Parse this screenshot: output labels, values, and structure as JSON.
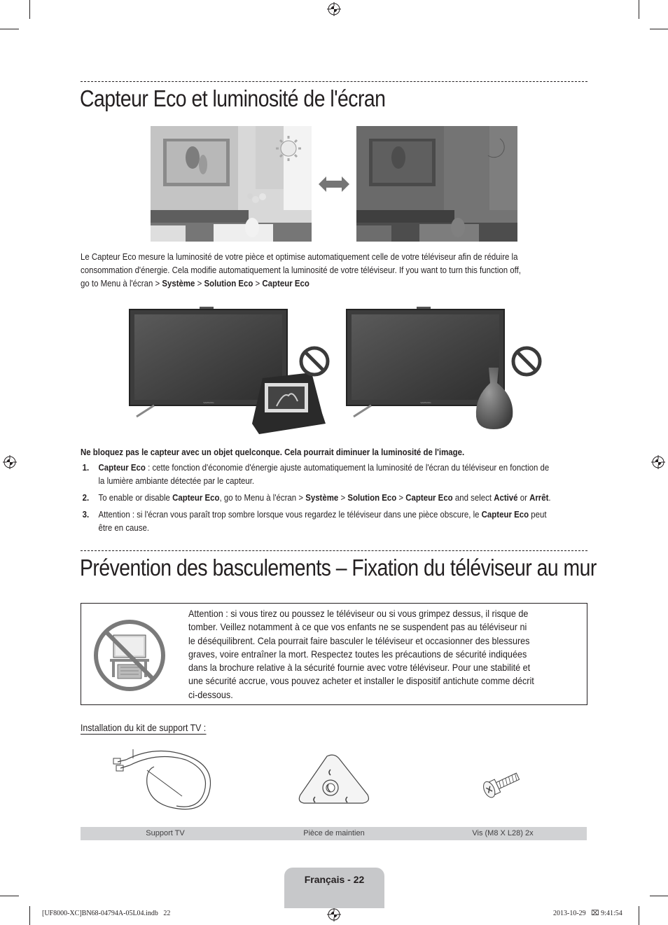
{
  "section1": {
    "title": "Capteur Eco et luminosité de l'écran",
    "intro": {
      "line1": "Le Capteur Eco mesure la luminosité de votre pièce et optimise automatiquement celle de votre téléviseur afin de réduire la",
      "line2": "consommation d'énergie. Cela modifie automatiquement la luminosité de votre téléviseur. If you want to turn this function off,",
      "line3_prefix": "go to Menu à l'écran > ",
      "path1": "Système",
      "sep": " > ",
      "path2": "Solution Eco",
      "path3": "Capteur Eco"
    },
    "warning": "Ne bloquez pas le capteur avec un objet quelconque. Cela pourrait diminuer la luminosité de l'image.",
    "items": [
      {
        "num": "1.",
        "bold_lead": "Capteur Eco",
        "line1": " : cette fonction d'économie d'énergie ajuste automatiquement la luminosité de l'écran du téléviseur en fonction de",
        "line2": "la lumière ambiante détectée par le capteur."
      },
      {
        "num": "2.",
        "t1": "To enable or disable ",
        "b1": "Capteur Eco",
        "t2": ", go to Menu à l'écran > ",
        "b2": "Système",
        "t3": " > ",
        "b3": "Solution Eco",
        "t4": " > ",
        "b4": "Capteur Eco",
        "t5": " and select ",
        "b5": "Activé",
        "t6": " or ",
        "b6": "Arrêt",
        "t7": "."
      },
      {
        "num": "3.",
        "t1": "Attention : si l'écran vous paraît trop sombre lorsque vous regardez le téléviseur dans une pièce obscure, le ",
        "b1": "Capteur Eco",
        "t2": " peut",
        "line2": "être en cause."
      }
    ],
    "tv_brand": "SAMSUNG"
  },
  "section2": {
    "title": "Prévention des basculements – Fixation du téléviseur au mur",
    "warning_lines": [
      "Attention : si vous tirez ou poussez le téléviseur ou si vous grimpez dessus, il risque de",
      "tomber. Veillez notamment à ce que vos enfants ne se suspendent pas au téléviseur ni",
      "le déséquilibrent. Cela pourrait faire basculer le téléviseur et occasionner des blessures",
      "graves, voire entraîner la mort. Respectez toutes les précautions de sécurité indiquées",
      "dans la brochure relative à la sécurité fournie avec votre téléviseur. Pour une stabilité et",
      "une sécurité accrue, vous pouvez acheter et installer le dispositif antichute comme décrit",
      "ci-dessous."
    ],
    "kit_heading": "Installation du kit de support TV :",
    "kit_items": [
      "Support TV",
      "Pièce de maintien",
      "Vis (M8 X L28) 2x"
    ]
  },
  "footer": {
    "page_label": "Français - 22",
    "file_info": "[UF8000-XC]BN68-04794A-05L04.indb   22",
    "timestamp": "2013-10-29   ⌧ 9:41:54"
  }
}
